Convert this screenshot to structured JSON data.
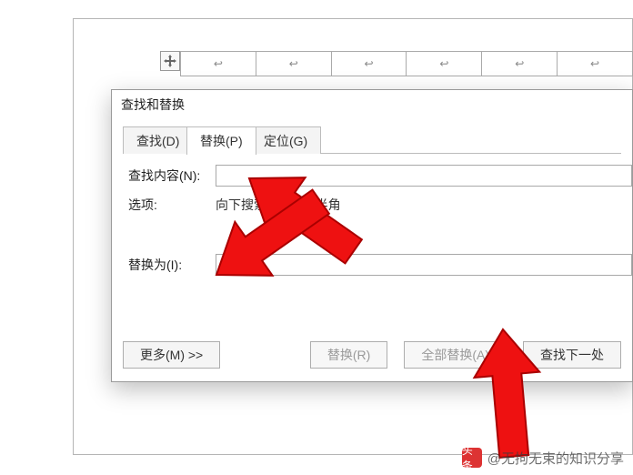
{
  "dialog": {
    "title": "查找和替换",
    "tabs": {
      "find": "查找(D)",
      "replace": "替换(P)",
      "goto": "定位(G)"
    },
    "find_label": "查找内容(N):",
    "find_value": "",
    "options_label": "选项:",
    "options_value": "向下搜索, 区分全/半角",
    "replace_label": "替换为(I):",
    "replace_value": "",
    "buttons": {
      "more": "更多(M) >>",
      "replace": "替换(R)",
      "replace_all": "全部替换(A)",
      "find_next": "查找下一处"
    }
  },
  "watermark": {
    "prefix": "头条",
    "text": "@无拘无束的知识分享"
  },
  "table": {
    "cell_marker": "↩"
  }
}
